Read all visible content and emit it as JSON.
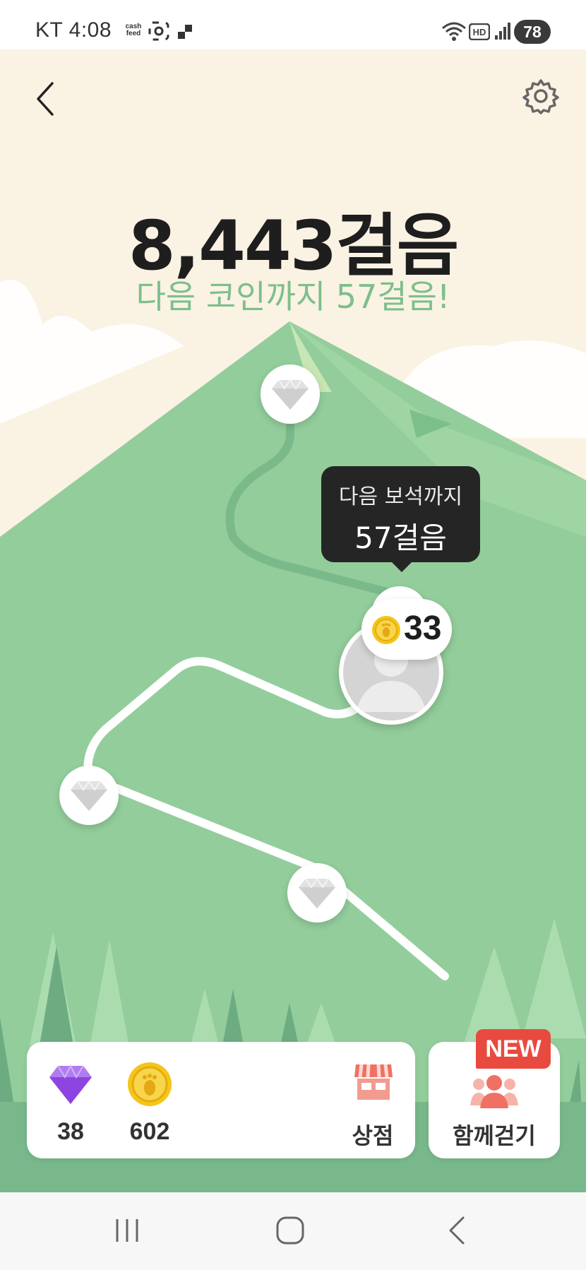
{
  "status_bar": {
    "carrier_time": "KT 4:08",
    "cashfeed_label": "cash feed",
    "battery": "78",
    "icons": [
      "cashfeed-icon",
      "screenshot-icon",
      "app-icon",
      "wifi-icon",
      "hd-icon",
      "signal-icon",
      "battery-icon"
    ]
  },
  "header": {
    "back_icon": "chevron-left-icon",
    "settings_icon": "gear-icon"
  },
  "steps": {
    "total": "8,443걸음",
    "next_coin": "다음 코인까지 57걸음!"
  },
  "map": {
    "tooltip_line1": "다음 보석까지",
    "tooltip_line2": "57걸음",
    "coin_bubble_count": "33",
    "gem_nodes": [
      "gem-node-top",
      "gem-node-left",
      "gem-node-bottom"
    ]
  },
  "wallet": {
    "gems": "38",
    "coins": "602",
    "shop_label": "상점"
  },
  "together": {
    "label": "함께걷기",
    "badge": "NEW"
  },
  "colors": {
    "background": "#faf2e3",
    "mountain": "#93cd9b",
    "accent_green": "#7cbf8b",
    "badge_red": "#e94a3f",
    "coin_gold": "#f5c518",
    "gem_purple": "#9b59e6"
  }
}
